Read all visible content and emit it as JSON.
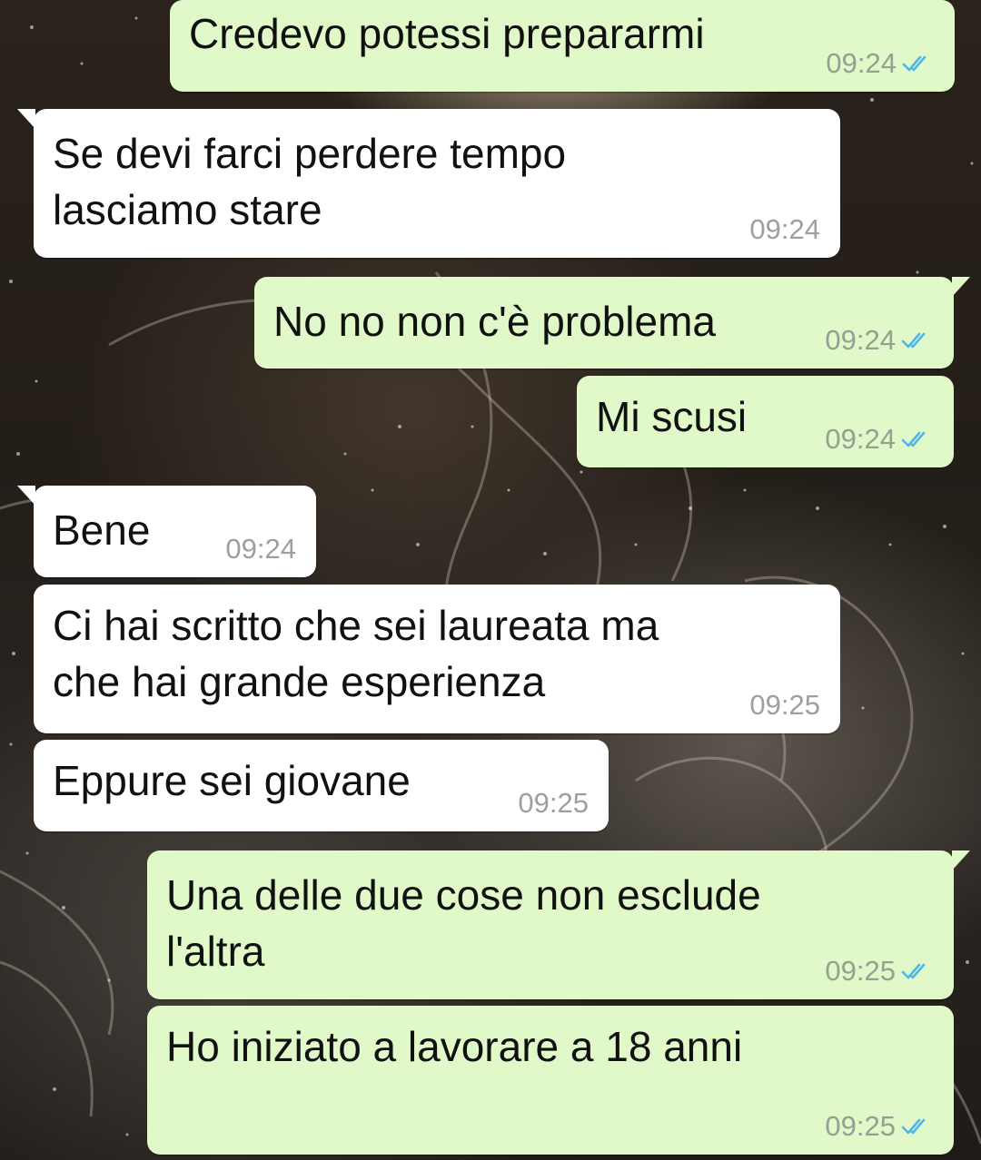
{
  "colors": {
    "outgoing_bubble": "#e1f9c9",
    "incoming_bubble": "#ffffff",
    "read_ticks": "#4fb6ec",
    "timestamp": "#93a092"
  },
  "icons": {
    "read_receipt": "double-check-icon"
  },
  "messages": [
    {
      "direction": "outgoing",
      "text": "Credevo potessi prepararmi",
      "time": "09:24",
      "status": "read"
    },
    {
      "direction": "incoming",
      "text": "Se devi farci perdere tempo\nlasciamo stare",
      "time": "09:24"
    },
    {
      "direction": "outgoing",
      "text": "No no non c'è problema",
      "time": "09:24",
      "status": "read"
    },
    {
      "direction": "outgoing",
      "text": "Mi scusi",
      "time": "09:24",
      "status": "read"
    },
    {
      "direction": "incoming",
      "text": "Bene",
      "time": "09:24"
    },
    {
      "direction": "incoming",
      "text": "Ci hai scritto che sei laureata ma\nche hai grande esperienza",
      "time": "09:25"
    },
    {
      "direction": "incoming",
      "text": "Eppure sei giovane",
      "time": "09:25"
    },
    {
      "direction": "outgoing",
      "text": "Una delle due cose non esclude\nl'altra",
      "time": "09:25",
      "status": "read"
    },
    {
      "direction": "outgoing",
      "text": "Ho iniziato a lavorare a 18 anni",
      "time": "09:25",
      "status": "read"
    }
  ]
}
